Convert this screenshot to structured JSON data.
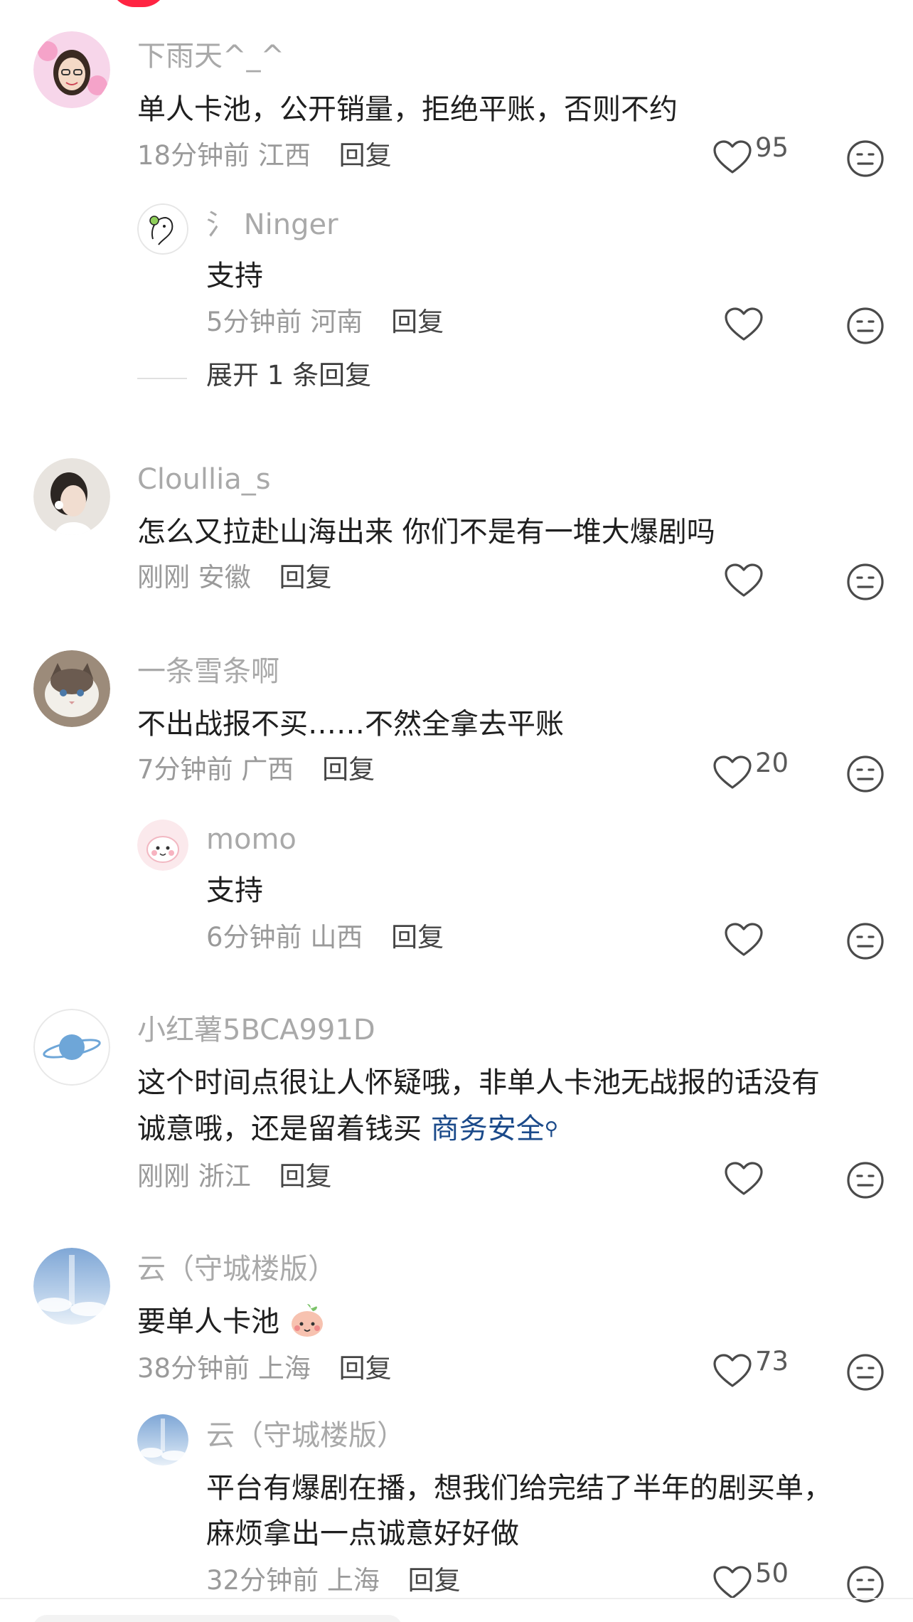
{
  "reply_label": "回复",
  "comments": [
    {
      "username": "下雨天^_^",
      "text_lines": [
        "单人卡池，公开销量，拒绝平账，否则不约"
      ],
      "time": "18分钟前",
      "location": "江西",
      "likes": "95",
      "replies": [
        {
          "username": "氵 Ninger",
          "text_lines": [
            "支持"
          ],
          "time": "5分钟前",
          "location": "河南",
          "likes": ""
        }
      ],
      "expand_label": "展开 1 条回复"
    },
    {
      "username": "Cloullia_s",
      "text_lines": [
        "怎么又拉赴山海出来 你们不是有一堆大爆剧吗"
      ],
      "time": "刚刚",
      "location": "安徽",
      "likes": ""
    },
    {
      "username": "一条雪条啊",
      "text_lines": [
        "不出战报不买……不然全拿去平账"
      ],
      "time": "7分钟前",
      "location": "广西",
      "likes": "20",
      "replies": [
        {
          "username": "momo",
          "text_lines": [
            "支持"
          ],
          "time": "6分钟前",
          "location": "山西",
          "likes": ""
        }
      ]
    },
    {
      "username": "小红薯5BCA991D",
      "text_lines": [
        "这个时间点很让人怀疑哦，非单人卡池无战报的话没有",
        "诚意哦，还是留着钱买"
      ],
      "topic_link": "商务安全",
      "time": "刚刚",
      "location": "浙江",
      "likes": ""
    },
    {
      "username": "云（守城楼版）",
      "text_lines": [
        "要单人卡池"
      ],
      "emoji": "😊",
      "time": "38分钟前",
      "location": "上海",
      "likes": "73",
      "replies": [
        {
          "username": "云（守城楼版）",
          "text_lines": [
            "平台有爆剧在播，想我们给完结了半年的剧买单，",
            "麻烦拿出一点诚意好好做"
          ],
          "time": "32分钟前",
          "location": "上海",
          "likes": "50"
        }
      ]
    }
  ],
  "colors": {
    "accent": "#ff2442",
    "username": "#a9a9a9",
    "text": "#1f1f1f",
    "meta": "#9a9a9a",
    "link": "#1b4a8a"
  },
  "icons": [
    "heart-icon",
    "neutral-face-icon",
    "search-icon"
  ]
}
